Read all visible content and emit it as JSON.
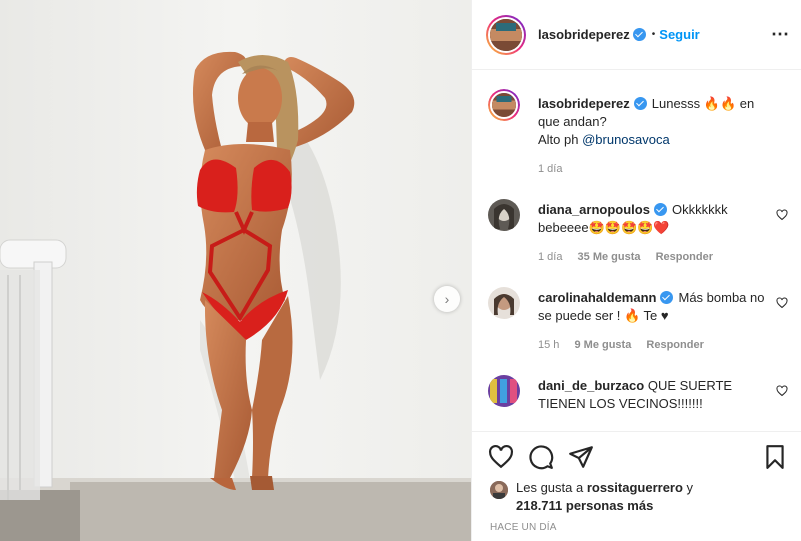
{
  "header": {
    "username": "lasobrideperez",
    "separator": "•",
    "follow_label": "Seguir",
    "more_label": "⋯"
  },
  "caption": {
    "username": "lasobrideperez",
    "text_before": "Lunesss 🔥🔥 en que andan?",
    "text_line2": "Alto ph ",
    "mention": "@brunosavoca",
    "time": "1 día"
  },
  "comments": [
    {
      "username": "diana_arnopoulos",
      "text": "Okkkkkkk bebeeee🤩🤩🤩🤩❤️",
      "time": "1 día",
      "likes": "35 Me gusta",
      "reply": "Responder"
    },
    {
      "username": "carolinahaldemann",
      "text": "Más bomba no se puede ser ! 🔥 Te ♥",
      "time": "15 h",
      "likes": "9 Me gusta",
      "reply": "Responder"
    },
    {
      "username": "dani_de_burzaco",
      "text": "QUE SUERTE TIENEN LOS VECINOS!!!!!!!"
    }
  ],
  "likes": {
    "prefix": "Les gusta a ",
    "user": "rossitaguerrero",
    "suffix": " y",
    "count": "218.711 personas más"
  },
  "posted": "HACE UN DÍA",
  "icons": {
    "next": "chevron-right-icon",
    "like": "heart-icon",
    "comment": "comment-icon",
    "share": "paper-plane-icon",
    "save": "bookmark-icon"
  },
  "colors": {
    "link": "#0095f6",
    "verified": "#3897f0",
    "mention": "#00376b",
    "muted": "#8e8e8e"
  }
}
